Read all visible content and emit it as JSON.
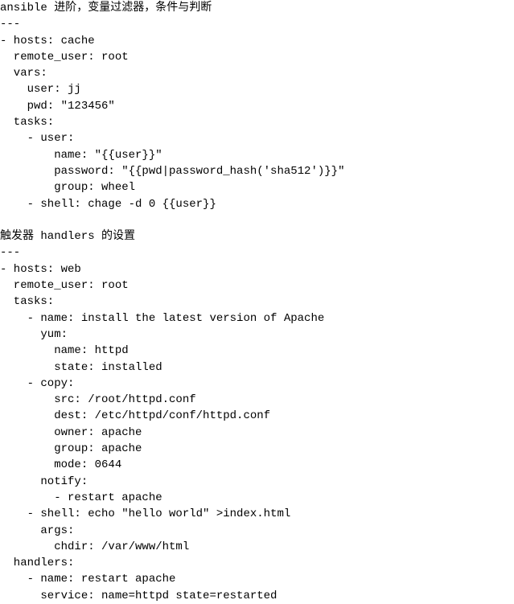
{
  "code": "ansible 进阶，变量过滤器，条件与判断\n---\n- hosts: cache\n  remote_user: root\n  vars:\n    user: jj\n    pwd: \"123456\"\n  tasks:\n    - user:\n        name: \"{{user}}\"\n        password: \"{{pwd|password_hash('sha512')}}\"\n        group: wheel\n    - shell: chage -d 0 {{user}}\n\n触发器 handlers 的设置\n---\n- hosts: web\n  remote_user: root\n  tasks:\n    - name: install the latest version of Apache\n      yum:\n        name: httpd\n        state: installed\n    - copy:\n        src: /root/httpd.conf\n        dest: /etc/httpd/conf/httpd.conf\n        owner: apache\n        group: apache\n        mode: 0644\n      notify:\n        - restart apache\n    - shell: echo \"hello world\" >index.html\n      args:\n        chdir: /var/www/html\n  handlers:\n    - name: restart apache\n      service: name=httpd state=restarted"
}
